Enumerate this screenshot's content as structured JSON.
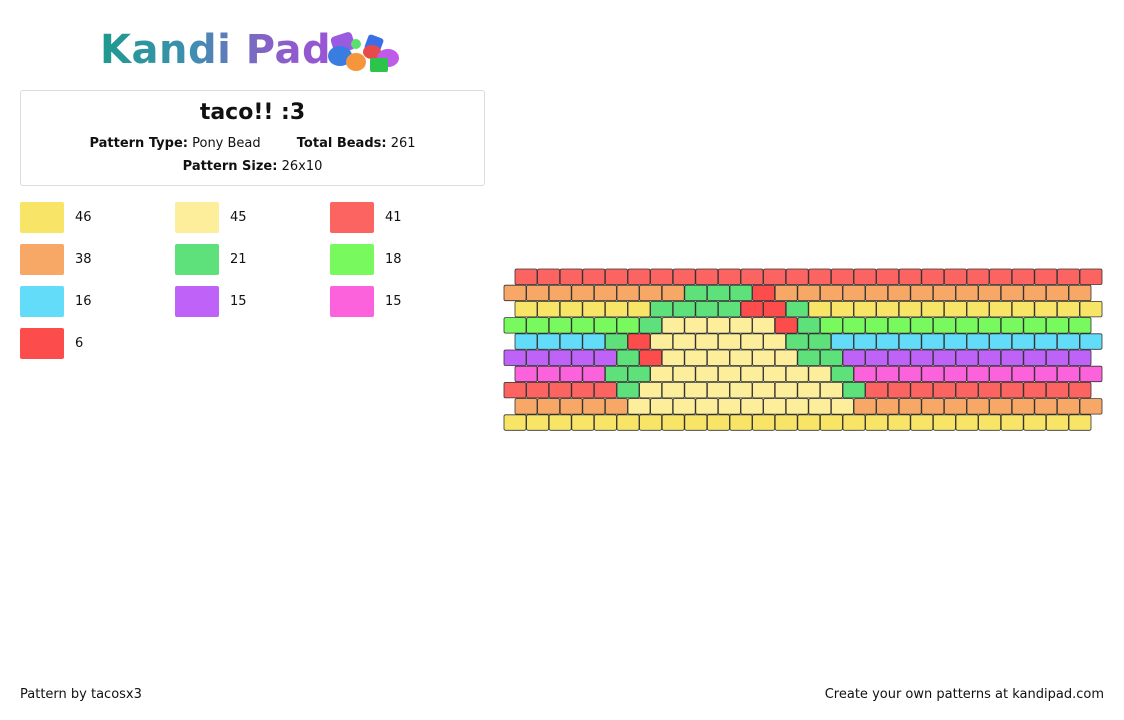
{
  "header": {
    "logo_text": "Kandi Pad"
  },
  "pattern_info": {
    "title": "taco!! :3",
    "type_label": "Pattern Type:",
    "type_value": "Pony Bead",
    "beads_label": "Total Beads:",
    "beads_value": "261",
    "size_label": "Pattern Size:",
    "size_value": "26x10"
  },
  "legend": [
    {
      "color": "#f8e466",
      "count": "46"
    },
    {
      "color": "#fdee9c",
      "count": "45"
    },
    {
      "color": "#fc6462",
      "count": "41"
    },
    {
      "color": "#f8a866",
      "count": "38"
    },
    {
      "color": "#5ee07a",
      "count": "21"
    },
    {
      "color": "#78fa5e",
      "count": "18"
    },
    {
      "color": "#62dcf8",
      "count": "16"
    },
    {
      "color": "#be62f8",
      "count": "15"
    },
    {
      "color": "#fc62dc",
      "count": "15"
    },
    {
      "color": "#fd4c4c",
      "count": "6"
    }
  ],
  "bead_palette": {
    "Y": "#f8e466",
    "L": "#fdee9c",
    "R": "#fc6462",
    "O": "#f8a866",
    "G": "#5ee07a",
    "M": "#78fa5e",
    "C": "#62dcf8",
    "P": "#be62f8",
    "K": "#fc62dc",
    "D": "#fd4c4c"
  },
  "bead_rows": [
    "RRRRRRRRRRRRRRRRRRRRRRRRRR",
    "OOOOOOOOGGGDOOOOOOOOOOOOOO",
    "YYYYYYGGGGDDGYYYYYYYYYYYYY",
    "MMMMMMGLLLLLDGMMMMMMMMMMMM",
    "CCCCGDLLLLLLGGCCCCCCCCCCCC",
    "PPPPPGDLLLLLLGGPPPPPPPPPPP",
    "KKKKGGLLLLLLLLGKKKKKKKKKKK",
    "RRRRRGLLLLLLLLLGRRRRRRRRRR",
    "OOOOOLLLLLLLLLLOOOOOOOOOOO",
    "YYYYYYYYYYYYYYYYYYYYYYYYYY"
  ],
  "footer": {
    "left": "Pattern by tacosx3",
    "right": "Create your own patterns at kandipad.com"
  }
}
